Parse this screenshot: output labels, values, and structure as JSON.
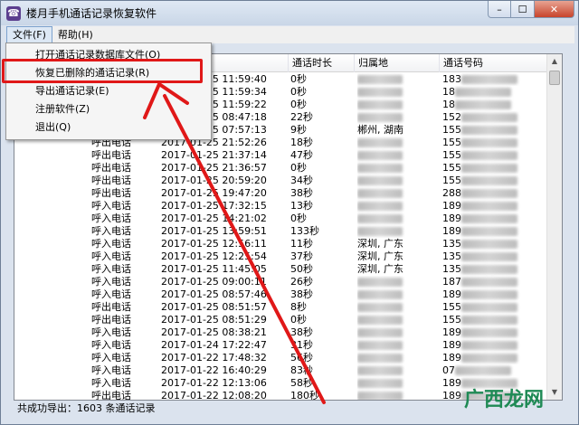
{
  "window": {
    "title": "楼月手机通话记录恢复软件"
  },
  "menubar": {
    "file": "文件(F)",
    "help": "帮助(H)"
  },
  "file_menu": {
    "items": [
      "打开通话记录数据库文件(O)",
      "恢复已删除的通话记录(R)",
      "导出通话记录(E)",
      "注册软件(Z)",
      "退出(Q)"
    ]
  },
  "columns": {
    "duration": "通话时长",
    "location": "归属地",
    "number": "通话号码"
  },
  "rows": [
    {
      "type": "",
      "date": "2017-01-25 11:59:40",
      "dur": "0秒",
      "loc": "",
      "num": "183"
    },
    {
      "type": "",
      "date": "2017-01-25 11:59:34",
      "dur": "0秒",
      "loc": "",
      "num": "18"
    },
    {
      "type": "",
      "date": "2017-01-25 11:59:22",
      "dur": "0秒",
      "loc": "",
      "num": "18"
    },
    {
      "type": "",
      "date": "2017-01-25 08:47:18",
      "dur": "22秒",
      "loc": "",
      "num": "152"
    },
    {
      "type": "",
      "date": "2017-01-25 07:57:13",
      "dur": "9秒",
      "loc": "郴州, 湖南",
      "num": "155"
    },
    {
      "type": "呼出电话",
      "date": "2017-01-25 21:52:26",
      "dur": "18秒",
      "loc": "",
      "num": "155"
    },
    {
      "type": "呼出电话",
      "date": "2017-01-25 21:37:14",
      "dur": "47秒",
      "loc": "",
      "num": "155"
    },
    {
      "type": "呼出电话",
      "date": "2017-01-25 21:36:57",
      "dur": "0秒",
      "loc": "",
      "num": "155"
    },
    {
      "type": "呼出电话",
      "date": "2017-01-25 20:59:20",
      "dur": "34秒",
      "loc": "",
      "num": "155"
    },
    {
      "type": "呼出电话",
      "date": "2017-01-25 19:47:20",
      "dur": "38秒",
      "loc": "",
      "num": "288"
    },
    {
      "type": "呼入电话",
      "date": "2017-01-25 17:32:15",
      "dur": "13秒",
      "loc": "",
      "num": "189"
    },
    {
      "type": "呼入电话",
      "date": "2017-01-25 14:21:02",
      "dur": "0秒",
      "loc": "",
      "num": "189"
    },
    {
      "type": "呼入电话",
      "date": "2017-01-25 13:59:51",
      "dur": "133秒",
      "loc": "",
      "num": "189"
    },
    {
      "type": "呼入电话",
      "date": "2017-01-25 12:56:11",
      "dur": "11秒",
      "loc": "深圳, 广东",
      "num": "135"
    },
    {
      "type": "呼入电话",
      "date": "2017-01-25 12:25:54",
      "dur": "37秒",
      "loc": "深圳, 广东",
      "num": "135"
    },
    {
      "type": "呼入电话",
      "date": "2017-01-25 11:45:05",
      "dur": "50秒",
      "loc": "深圳, 广东",
      "num": "135"
    },
    {
      "type": "呼入电话",
      "date": "2017-01-25 09:00:11",
      "dur": "26秒",
      "loc": "",
      "num": "187"
    },
    {
      "type": "呼入电话",
      "date": "2017-01-25 08:57:46",
      "dur": "38秒",
      "loc": "",
      "num": "189"
    },
    {
      "type": "呼出电话",
      "date": "2017-01-25 08:51:57",
      "dur": "8秒",
      "loc": "",
      "num": "155"
    },
    {
      "type": "呼出电话",
      "date": "2017-01-25 08:51:29",
      "dur": "0秒",
      "loc": "",
      "num": "155"
    },
    {
      "type": "呼入电话",
      "date": "2017-01-25 08:38:21",
      "dur": "38秒",
      "loc": "",
      "num": "189"
    },
    {
      "type": "呼入电话",
      "date": "2017-01-24 17:22:47",
      "dur": "31秒",
      "loc": "",
      "num": "189"
    },
    {
      "type": "呼入电话",
      "date": "2017-01-22 17:48:32",
      "dur": "56秒",
      "loc": "",
      "num": "189"
    },
    {
      "type": "呼入电话",
      "date": "2017-01-22 16:40:29",
      "dur": "83秒",
      "loc": "",
      "num": "07"
    },
    {
      "type": "呼入电话",
      "date": "2017-01-22 12:13:06",
      "dur": "58秒",
      "loc": "",
      "num": "189"
    },
    {
      "type": "呼出电话",
      "date": "2017-01-22 12:08:20",
      "dur": "180秒",
      "loc": "",
      "num": "189"
    }
  ],
  "status": {
    "text": "共成功导出：1603 条通话记录"
  },
  "watermark": {
    "text": "广西龙网"
  },
  "colors": {
    "highlight": "#e01818",
    "window_frame": "#dbe3ee",
    "close": "#c7442b"
  }
}
